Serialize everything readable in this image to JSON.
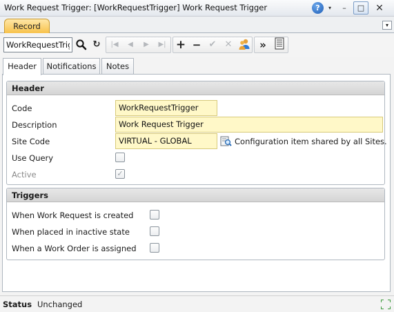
{
  "window": {
    "title": "Work Request Trigger: [WorkRequestTrigger] Work Request Trigger",
    "help_glyph": "?",
    "help_arrow": "▾",
    "minimize_glyph": "–",
    "restore_glyph": "□",
    "close_glyph": "✕"
  },
  "tabstrip": {
    "record_tab": "Record",
    "menu_glyph": "▾"
  },
  "toolbar": {
    "record_value": "WorkRequestTrig",
    "icons": [
      "search-icon",
      "refresh-icon",
      "first-record-icon",
      "prev-record-icon",
      "next-record-icon",
      "last-record-icon",
      "add-icon",
      "remove-icon",
      "save-icon",
      "cancel-icon",
      "users-icon",
      "more-icon",
      "list-icon"
    ],
    "glyphs": {
      "search": "⚲",
      "refresh": "↻",
      "first": "|◀",
      "prev": "◀",
      "next": "▶",
      "last": "▶|",
      "add": "+",
      "remove": "−",
      "save": "✔",
      "cancel": "✕",
      "more": "»"
    }
  },
  "subtabs": [
    {
      "label": "Header",
      "active": true
    },
    {
      "label": "Notifications",
      "active": false
    },
    {
      "label": "Notes",
      "active": false
    }
  ],
  "header_panel": {
    "title": "Header",
    "fields": {
      "code": {
        "label": "Code",
        "value": "WorkRequestTrigger"
      },
      "description": {
        "label": "Description",
        "value": "Work Request Trigger"
      },
      "site_code": {
        "label": "Site Code",
        "value": "VIRTUAL - GLOBAL",
        "note": "Configuration item shared by all Sites."
      },
      "use_query": {
        "label": "Use Query",
        "checked": false
      },
      "active": {
        "label": "Active",
        "checked": true,
        "disabled": true,
        "glyph": "✓"
      }
    }
  },
  "triggers_panel": {
    "title": "Triggers",
    "items": [
      {
        "label": "When Work Request is created",
        "checked": false
      },
      {
        "label": "When placed in inactive state",
        "checked": false
      },
      {
        "label": "When a Work Order is assigned",
        "checked": false
      }
    ]
  },
  "status": {
    "label": "Status",
    "value": "Unchanged"
  },
  "colors": {
    "record_tab": "#f7c046",
    "field_background": "#fff8c8",
    "panel_header": "#d5d5d5"
  }
}
